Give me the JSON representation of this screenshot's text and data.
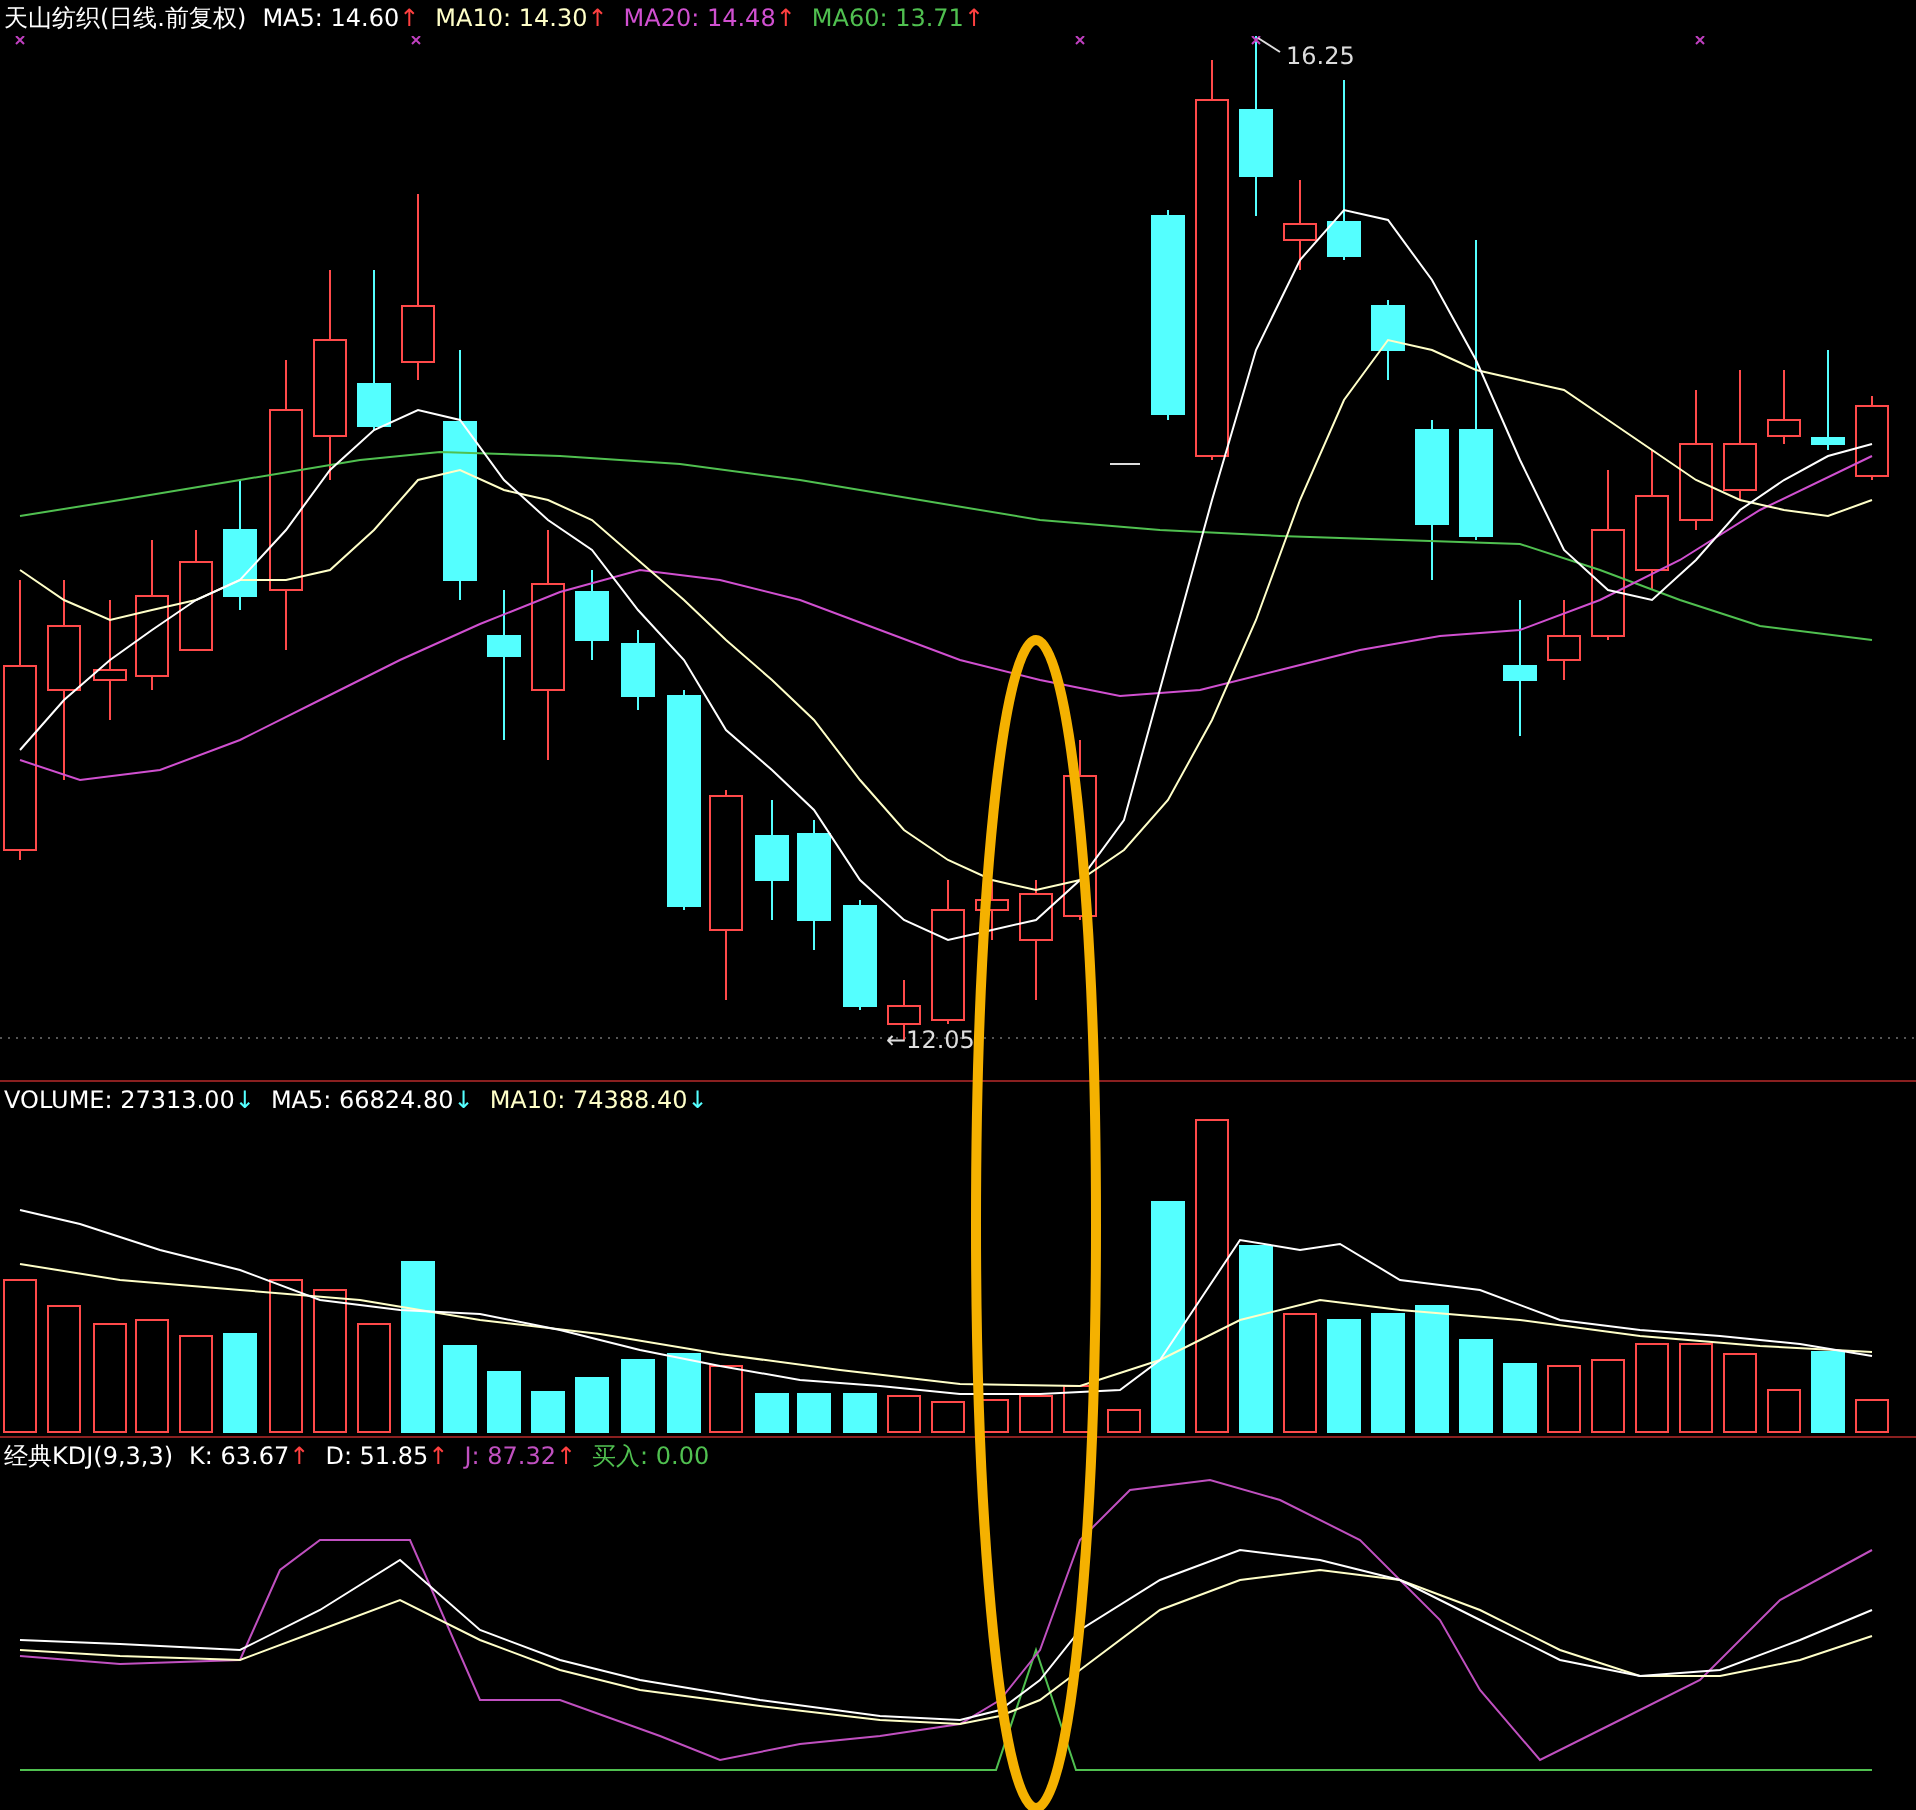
{
  "price_panel": {
    "title": "天山纺织(日线.前复权)",
    "legend": [
      {
        "label": "MA5: 14.60",
        "color": "#ffffff",
        "arrow": "↑",
        "kind": "rising"
      },
      {
        "label": "MA10: 14.30",
        "color": "#ffffc8",
        "arrow": "↑",
        "kind": "rising"
      },
      {
        "label": "MA20: 14.48",
        "color": "#d050d0",
        "arrow": "↑",
        "kind": "rising"
      },
      {
        "label": "MA60: 13.71",
        "color": "#50c050",
        "arrow": "↑",
        "kind": "rising"
      }
    ],
    "annotations": [
      {
        "kind": "high",
        "text": "16.25"
      },
      {
        "kind": "low",
        "text": "←12.05"
      }
    ]
  },
  "volume_panel": {
    "legend": [
      {
        "label": "VOLUME: 27313.00",
        "color": "#ffffff",
        "arrow": "↓",
        "kind": "falling"
      },
      {
        "label": "MA5: 66824.80",
        "color": "#ffffff",
        "arrow": "↓",
        "kind": "falling"
      },
      {
        "label": "MA10: 74388.40",
        "color": "#ffffc8",
        "arrow": "↓",
        "kind": "falling"
      }
    ]
  },
  "kdj_panel": {
    "title": "经典KDJ(9,3,3)",
    "legend": [
      {
        "label": "K: 63.67",
        "color": "#ffffff",
        "arrow": "↑",
        "kind": "rising"
      },
      {
        "label": "D: 51.85",
        "color": "#ffffff",
        "arrow": "↑",
        "kind": "rising"
      },
      {
        "label": "J: 87.32",
        "color": "#c050c0",
        "arrow": "↑",
        "kind": "rising"
      },
      {
        "label": "买入: 0.00",
        "color": "#50c050",
        "kind": "plain"
      }
    ]
  }
}
